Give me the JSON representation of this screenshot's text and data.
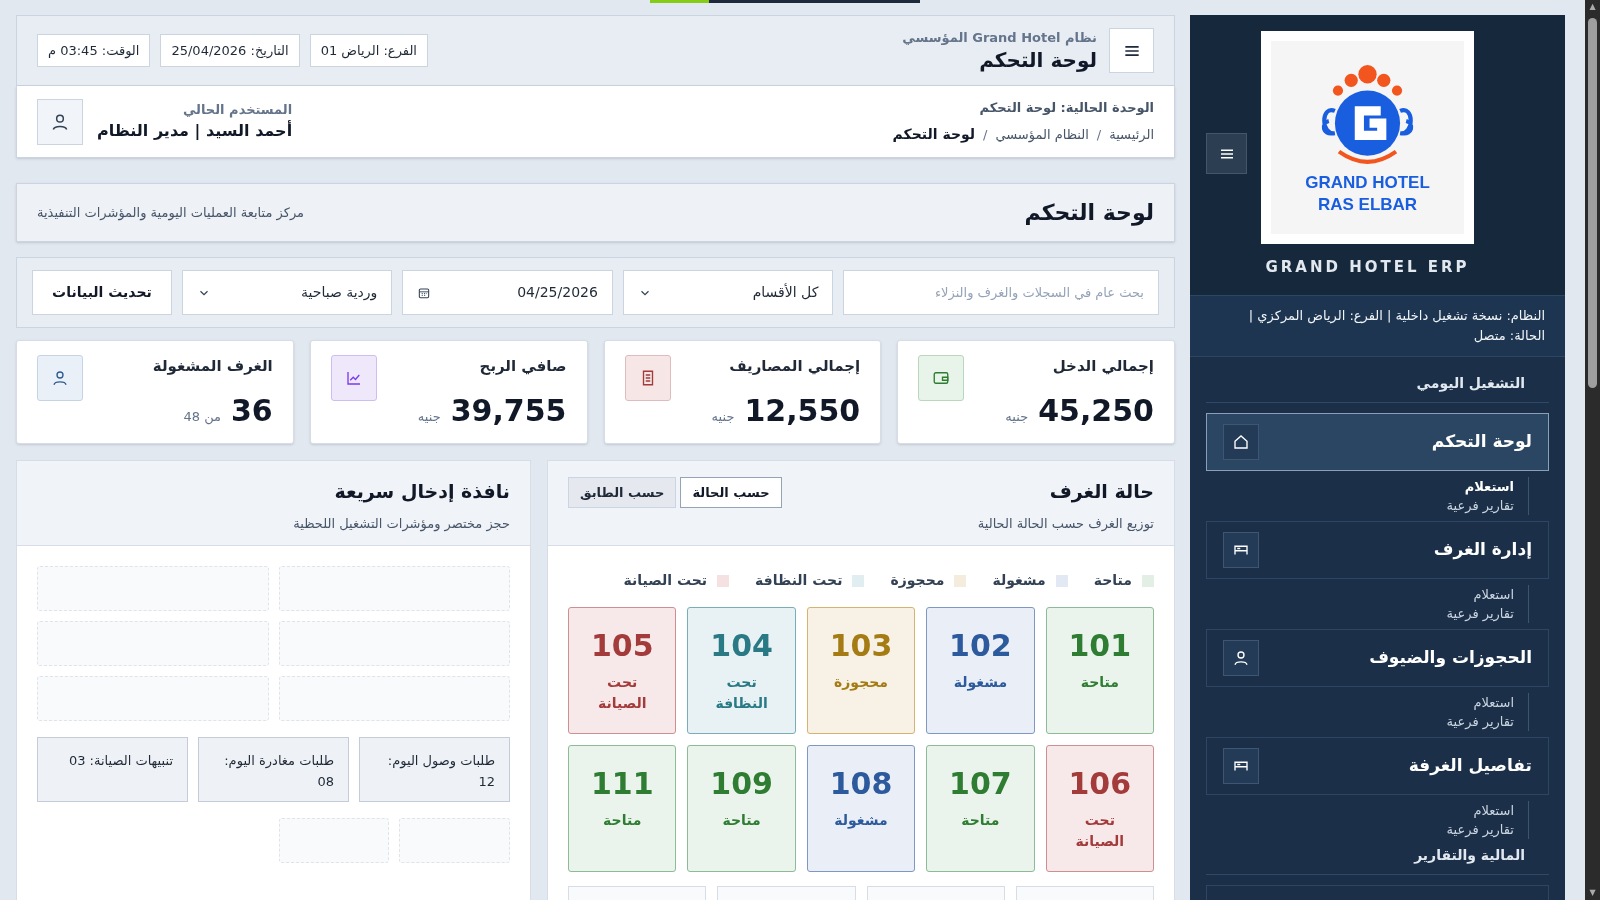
{
  "top_progress": {
    "level": 0.22
  },
  "scrollbar": {
    "up": "▲",
    "down": "▼"
  },
  "sidebar": {
    "logo": {
      "line1": "GRAND HOTEL",
      "line2": "RAS ELBAR"
    },
    "app_name": "GRAND HOTEL ERP",
    "info": "النظام: نسخة تشغيل داخلية | الفرع: الرياض المركزي | الحالة: متصل",
    "sections": [
      {
        "title": "التشغيل اليومي",
        "items": [
          {
            "label": "لوحة التحكم",
            "kind": "home",
            "selected": true,
            "children": [
              {
                "label": "استعلام",
                "selected": true
              },
              {
                "label": "تقارير فرعية",
                "selected": false
              }
            ]
          },
          {
            "label": "إدارة الغرف",
            "kind": "bed",
            "selected": false,
            "children": [
              {
                "label": "استعلام",
                "selected": false
              },
              {
                "label": "تقارير فرعية",
                "selected": false
              }
            ]
          },
          {
            "label": "الحجوزات والضيوف",
            "kind": "user",
            "selected": false,
            "children": [
              {
                "label": "استعلام",
                "selected": false
              },
              {
                "label": "تقارير فرعية",
                "selected": false
              }
            ]
          },
          {
            "label": "تفاصيل الغرفة",
            "kind": "bed",
            "selected": false,
            "children": [
              {
                "label": "استعلام",
                "selected": false
              },
              {
                "label": "تقارير فرعية",
                "selected": false
              }
            ]
          }
        ]
      },
      {
        "title": "المالية والتقارير"
      }
    ]
  },
  "header": {
    "subtitle": "نظام Grand Hotel المؤسسي",
    "title": "لوحة التحكم",
    "chips": [
      "الفرع: الرياض 01",
      "التاريخ: 25/04/2026",
      "الوقت: 03:45 م"
    ],
    "current_unit": "الوحدة الحالية: لوحة التحكم",
    "breadcrumb": [
      "الرئيسية",
      "النظام المؤسسي",
      "لوحة التحكم"
    ],
    "breadcrumb_separators": [
      "/",
      "/"
    ],
    "user_label": "المستخدم الحالي",
    "user_name": "أحمد السيد | مدير النظام"
  },
  "page": {
    "title": "لوحة التحكم",
    "description": "مركز متابعة العمليات اليومية والمؤشرات التنفيذية"
  },
  "filters": {
    "search": {
      "placeholder": "بحث عام في السجلات والغرف والنزلاء"
    },
    "department": "كل الأقسام",
    "date": "04/25/2026",
    "shift": "وردية صباحية",
    "refresh": "تحديث البيانات"
  },
  "stats": [
    {
      "label": "إجمالي الدخل",
      "value": "45,250",
      "unit": "جنيه",
      "kind": "wallet"
    },
    {
      "label": "إجمالي المصاريف",
      "value": "12,550",
      "unit": "جنيه",
      "kind": "receipt"
    },
    {
      "label": "صافي الربح",
      "value": "39,755",
      "unit": "جنيه",
      "kind": "chart"
    },
    {
      "label": "الغرف المشغولة",
      "value": "36",
      "unit": "من 48",
      "kind": "user"
    }
  ],
  "rooms_panel": {
    "title": "حالة الغرف",
    "subtitle": "توزيع الغرف حسب الحالة الحالية",
    "tabs": [
      {
        "label": "حسب الحالة",
        "selected": true
      },
      {
        "label": "حسب الطابق",
        "selected": false
      }
    ],
    "legend": [
      {
        "label": "متاحة",
        "kind": "available"
      },
      {
        "label": "مشغولة",
        "kind": "occupied"
      },
      {
        "label": "محجوزة",
        "kind": "reserved"
      },
      {
        "label": "تحت النظافة",
        "kind": "cleaning"
      },
      {
        "label": "تحت الصيانة",
        "kind": "maintenance"
      }
    ],
    "rooms": [
      {
        "number": "101",
        "status": "متاحة",
        "kind": "available"
      },
      {
        "number": "102",
        "status": "مشغولة",
        "kind": "occupied"
      },
      {
        "number": "103",
        "status": "محجوزة",
        "kind": "reserved"
      },
      {
        "number": "104",
        "status": "تحت النظافة",
        "kind": "cleaning"
      },
      {
        "number": "105",
        "status": "تحت الصيانة",
        "kind": "maintenance"
      },
      {
        "number": "106",
        "status": "تحت الصيانة",
        "kind": "maintenance"
      },
      {
        "number": "107",
        "status": "متاحة",
        "kind": "available"
      },
      {
        "number": "108",
        "status": "مشغولة",
        "kind": "occupied"
      },
      {
        "number": "109",
        "status": "متاحة",
        "kind": "available"
      },
      {
        "number": "111",
        "status": "متاحة",
        "kind": "available"
      }
    ]
  },
  "quick_entry": {
    "title": "نافذة إدخال سريعة",
    "subtitle": "حجز مختصر ومؤشرات التشغيل اللحظية",
    "indicators": [
      "طلبات وصول اليوم: 12",
      "طلبات مغادرة اليوم: 08",
      "تنبيهات الصيانة: 03"
    ]
  }
}
